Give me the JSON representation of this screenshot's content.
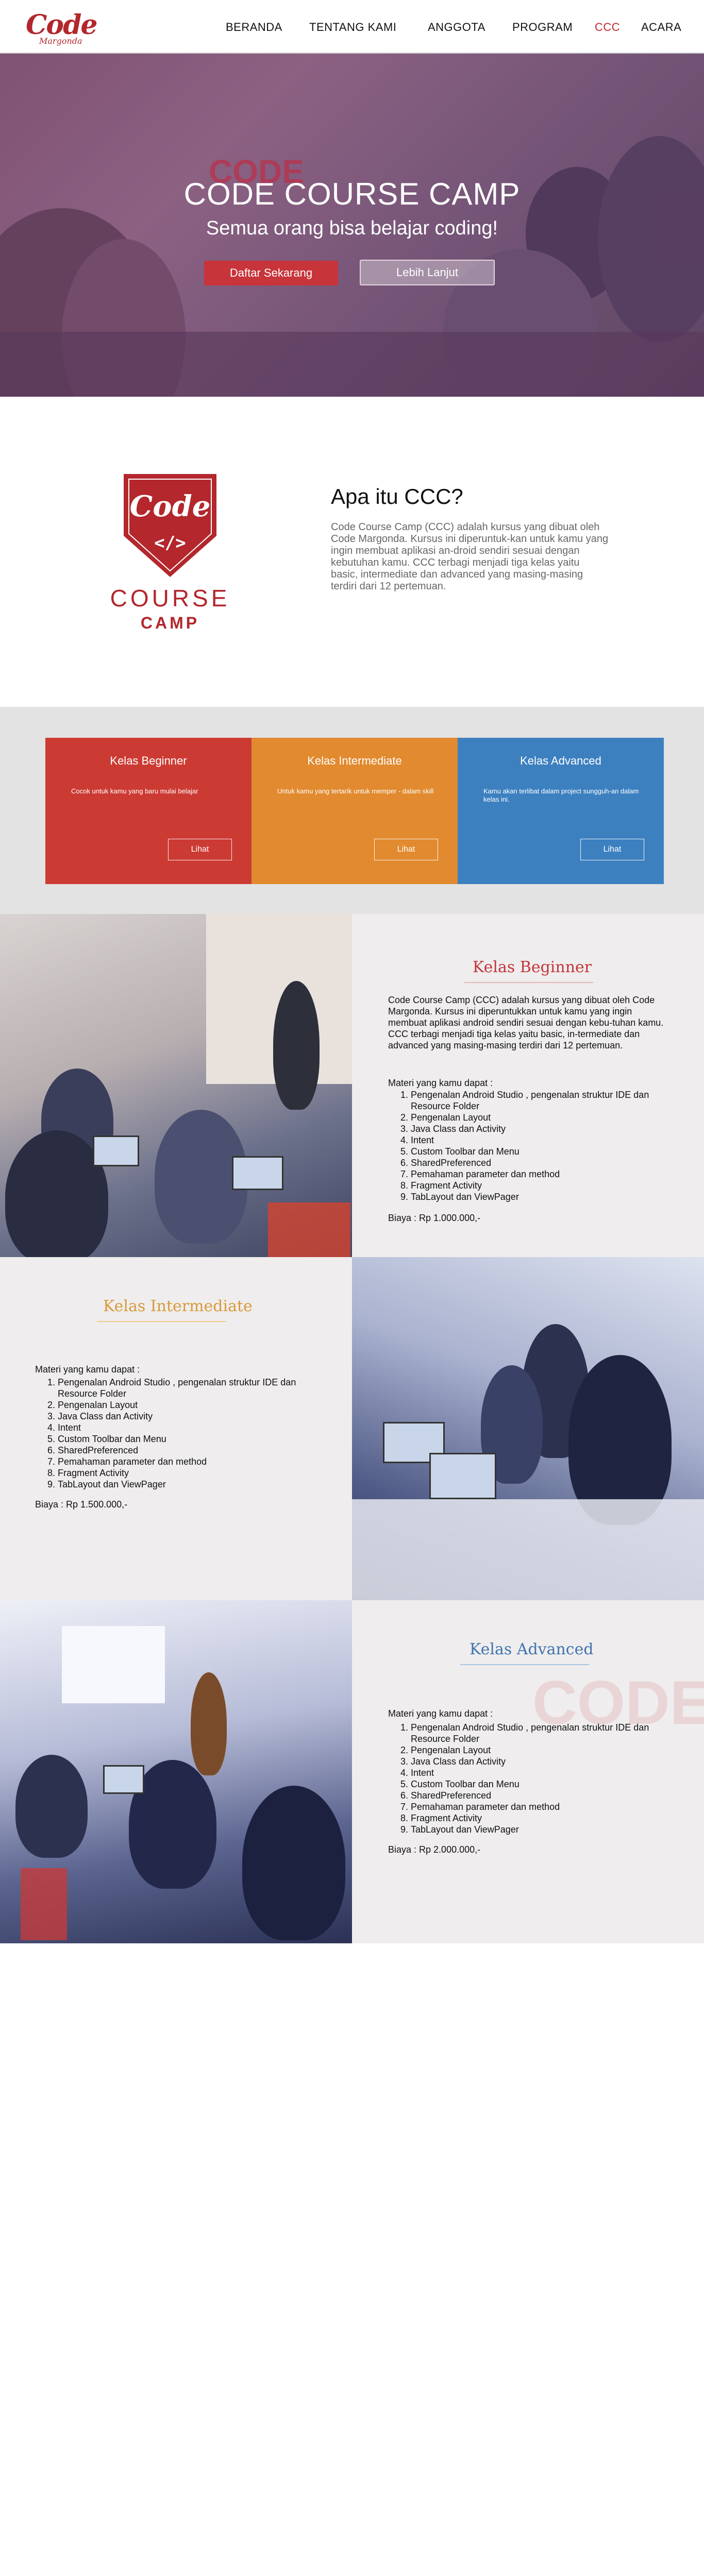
{
  "nav": {
    "logo_text": "Code",
    "logo_sub": "Margonda",
    "items": [
      {
        "label": "BERANDA",
        "active": false
      },
      {
        "label": "TENTANG KAMI",
        "active": false
      },
      {
        "label": "ANGGOTA",
        "active": false
      },
      {
        "label": "PROGRAM",
        "active": false
      },
      {
        "label": "CCC",
        "active": true
      },
      {
        "label": "ACARA",
        "active": false
      }
    ]
  },
  "hero": {
    "title": "CODE COURSE CAMP",
    "subtitle": "Semua orang bisa belajar coding!",
    "primary_button": "Daftar Sekarang",
    "secondary_button": "Lebih Lanjut",
    "banner_text": "CODE"
  },
  "about": {
    "logo_word": "Code",
    "logo_symbol": "</>",
    "logo_course": "COURSE",
    "logo_camp": "CAMP",
    "title": "Apa itu CCC?",
    "text": "Code Course Camp (CCC) adalah kursus yang dibuat oleh Code Margonda. Kursus ini diperuntuk-kan untuk kamu yang ingin membuat aplikasi an-droid sendiri sesuai dengan kebutuhan kamu. CCC terbagi menjadi tiga kelas yaitu basic, intermediate dan advanced yang masing-masing terdiri dari 12 pertemuan."
  },
  "cards": [
    {
      "title": "Kelas Beginner",
      "text": "Cocok untuk kamu yang baru mulai belajar",
      "button": "Lihat"
    },
    {
      "title": "Kelas Intermediate",
      "text": "Untuk kamu yang tertarik untuk memper - dalam skill",
      "button": "Lihat"
    },
    {
      "title": "Kelas Advanced",
      "text": "Kamu akan terlibat dalam project sungguh-an dalam kelas ini.",
      "button": "Lihat"
    }
  ],
  "beginner": {
    "title": "Kelas Beginner",
    "desc": "Code Course Camp (CCC) adalah kursus yang dibuat oleh Code Margonda. Kursus ini diperuntukkan untuk kamu yang ingin membuat aplikasi android sendiri sesuai dengan kebu-tuhan kamu. CCC terbagi menjadi tiga kelas yaitu basic, in-termediate dan advanced yang masing-masing terdiri dari 12 pertemuan.",
    "lead": "Materi yang kamu dapat :",
    "items": [
      "Pengenalan Android Studio , pengenalan struktur IDE dan Resource Folder",
      "Pengenalan Layout",
      "Java Class dan Activity",
      "Intent",
      "Custom Toolbar dan Menu",
      "SharedPreferenced",
      "Pemahaman parameter dan method",
      "Fragment Activity",
      "TabLayout dan ViewPager"
    ],
    "price": "Biaya : Rp 1.000.000,-"
  },
  "intermediate": {
    "title": "Kelas Intermediate",
    "lead": "Materi yang kamu dapat :",
    "items": [
      "Pengenalan Android Studio , pengenalan struktur IDE dan Resource Folder",
      "Pengenalan Layout",
      "Java Class dan Activity",
      "Intent",
      "Custom Toolbar dan Menu",
      "SharedPreferenced",
      "Pemahaman parameter dan method",
      "Fragment Activity",
      "TabLayout dan ViewPager"
    ],
    "price": "Biaya : Rp 1.500.000,-"
  },
  "advanced": {
    "title": "Kelas Advanced",
    "watermark": "CODE",
    "lead": "Materi yang kamu dapat :",
    "items": [
      "Pengenalan Android Studio , pengenalan struktur IDE dan Resource Folder",
      "Pengenalan Layout",
      "Java Class dan Activity",
      "Intent",
      "Custom Toolbar dan Menu",
      "SharedPreferenced",
      "Pemahaman parameter dan method",
      "Fragment Activity",
      "TabLayout dan ViewPager"
    ],
    "price": "Biaya : Rp 2.000.000,-"
  },
  "colors": {
    "brand_red": "#b3272d",
    "card_beginner": "#cc3b33",
    "card_intermediate": "#e18a2f",
    "card_advanced": "#3d80c0",
    "title_beginner": "#c2343a",
    "title_intermediate": "#d99a3a",
    "title_advanced": "#3f74b0"
  }
}
